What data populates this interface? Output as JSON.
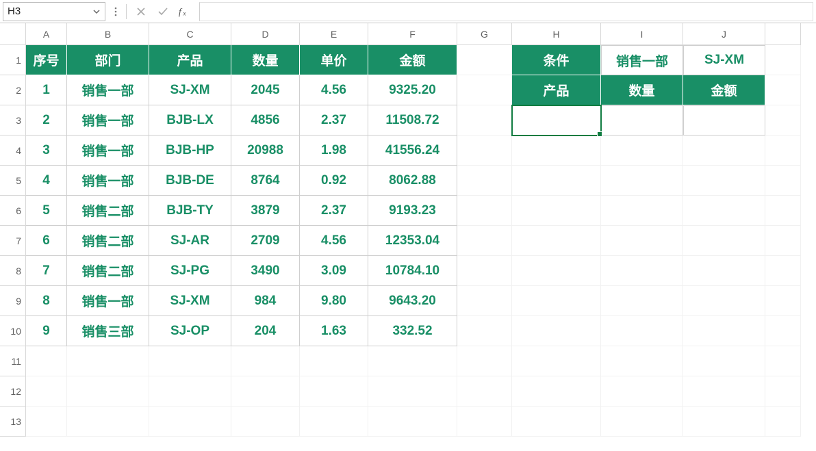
{
  "formula_bar": {
    "name_box": "H3",
    "formula_value": ""
  },
  "columns": {
    "A": "A",
    "B": "B",
    "C": "C",
    "D": "D",
    "E": "E",
    "F": "F",
    "G": "G",
    "H": "H",
    "I": "I",
    "J": "J",
    "K": ""
  },
  "row_labels": {
    "r1": "1",
    "r2": "2",
    "r3": "3",
    "r4": "4",
    "r5": "5",
    "r6": "6",
    "r7": "7",
    "r8": "8",
    "r9": "9",
    "r10": "10",
    "r11": "11",
    "r12": "12",
    "r13": "13"
  },
  "table_headers": {
    "seq": "序号",
    "dept": "部门",
    "product": "产品",
    "qty": "数量",
    "price": "单价",
    "amount": "金额"
  },
  "rows": [
    {
      "seq": "1",
      "dept": "销售一部",
      "product": "SJ-XM",
      "qty": "2045",
      "price": "4.56",
      "amount": "9325.20"
    },
    {
      "seq": "2",
      "dept": "销售一部",
      "product": "BJB-LX",
      "qty": "4856",
      "price": "2.37",
      "amount": "11508.72"
    },
    {
      "seq": "3",
      "dept": "销售一部",
      "product": "BJB-HP",
      "qty": "20988",
      "price": "1.98",
      "amount": "41556.24"
    },
    {
      "seq": "4",
      "dept": "销售一部",
      "product": "BJB-DE",
      "qty": "8764",
      "price": "0.92",
      "amount": "8062.88"
    },
    {
      "seq": "5",
      "dept": "销售二部",
      "product": "BJB-TY",
      "qty": "3879",
      "price": "2.37",
      "amount": "9193.23"
    },
    {
      "seq": "6",
      "dept": "销售二部",
      "product": "SJ-AR",
      "qty": "2709",
      "price": "4.56",
      "amount": "12353.04"
    },
    {
      "seq": "7",
      "dept": "销售二部",
      "product": "SJ-PG",
      "qty": "3490",
      "price": "3.09",
      "amount": "10784.10"
    },
    {
      "seq": "8",
      "dept": "销售一部",
      "product": "SJ-XM",
      "qty": "984",
      "price": "9.80",
      "amount": "9643.20"
    },
    {
      "seq": "9",
      "dept": "销售三部",
      "product": "SJ-OP",
      "qty": "204",
      "price": "1.63",
      "amount": "332.52"
    }
  ],
  "criteria": {
    "h1": "条件",
    "i1": "销售一部",
    "j1": "SJ-XM",
    "h2": "产品",
    "i2": "数量",
    "j2": "金额",
    "h3": "",
    "i3": "",
    "j3": ""
  },
  "colors": {
    "accent": "#107c41",
    "teal": "#198f66"
  },
  "icons": {
    "dropdown": "chevron-down-icon",
    "cancel": "x-icon",
    "accept": "check-icon",
    "fx": "fx-icon",
    "dots": "dots-icon"
  }
}
